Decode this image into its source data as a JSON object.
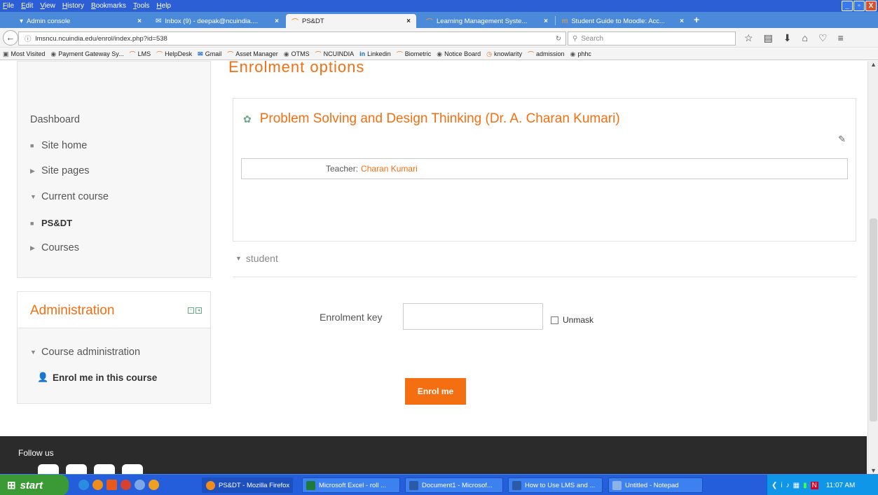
{
  "menu": [
    "File",
    "Edit",
    "View",
    "History",
    "Bookmarks",
    "Tools",
    "Help"
  ],
  "window_controls": {
    "minimize": "_",
    "restore": "▫",
    "close": "X"
  },
  "tabs": [
    {
      "label": "Admin console",
      "icon": "tab-icon-admin"
    },
    {
      "label": "Inbox (9) - deepak@ncuindia.... ",
      "icon": "gmail-icon"
    },
    {
      "label": "PS&DT",
      "icon": "moodle-icon",
      "active": true
    },
    {
      "label": "Learning Management Syste...",
      "icon": "moodle-icon"
    },
    {
      "label": "Student Guide to Moodle: Acc...",
      "icon": "moodle-icon"
    }
  ],
  "tab_close": "×",
  "new_tab": "+",
  "url": "lmsncu.ncuindia.edu/enrol/index.php?id=538",
  "search_placeholder": "Search",
  "bookmarks": [
    "Most Visited",
    "Payment Gateway Sy...",
    "LMS",
    "HelpDesk",
    "Gmail",
    "Asset Manager",
    "OTMS",
    "NCUINDIA",
    "Linkedin",
    "Biometric",
    "Notice Board",
    "knowlarity",
    "admission",
    "phhc"
  ],
  "page": {
    "heading_cut": "Enrolment options",
    "nav": {
      "dashboard": "Dashboard",
      "site_home": "Site home",
      "site_pages": "Site pages",
      "current_course": "Current course",
      "course_short": "PS&DT",
      "courses": "Courses"
    },
    "admin": {
      "title": "Administration",
      "course_admin": "Course administration",
      "enrol_link": "Enrol me in this course"
    },
    "course": {
      "title": "Problem Solving and Design Thinking (Dr. A. Charan Kumari)",
      "teacher_label": "Teacher:",
      "teacher_name": "Charan Kumari"
    },
    "student_section": "student",
    "enrol_key_label": "Enrolment key",
    "enrol_key_value": "",
    "unmask_label": "Unmask",
    "enrol_button": "Enrol me",
    "footer_follow": "Follow us"
  },
  "taskbar": {
    "start": "start",
    "tasks": [
      "PS&DT - Mozilla Firefox",
      "Microsoft Excel - roll ...",
      "Document1 - Microsof...",
      "How to Use LMS and ...",
      "Untitled - Notepad"
    ],
    "clock": "11:07 AM"
  },
  "colors": {
    "accent": "#f36f12",
    "taskbar": "#245edb",
    "start": "#3c9a36",
    "footer": "#2b2b2b"
  }
}
